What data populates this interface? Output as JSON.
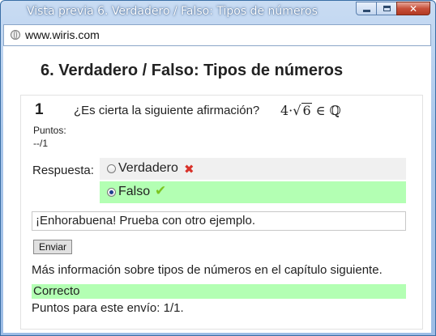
{
  "window": {
    "title": "Vista previa 6. Verdadero / Falso: Tipos de números",
    "close_glyph": "✕"
  },
  "address": {
    "url": "www.wiris.com"
  },
  "page": {
    "title": "6. Verdadero / Falso: Tipos de números",
    "question": {
      "number": "1",
      "text": "¿Es cierta la siguiente afirmación?",
      "math": {
        "coef": "4·",
        "radical": "√",
        "radicand": "6",
        "rel": " ∈ ℚ"
      },
      "points_label": "Puntos:",
      "points_value": "--/1",
      "answer_label": "Respuesta:",
      "options": [
        {
          "label": "Verdadero",
          "selected": false,
          "mark": "✖",
          "mark_icon": "cross-icon"
        },
        {
          "label": "Falso",
          "selected": true,
          "mark": "✔",
          "mark_icon": "check-icon"
        }
      ],
      "feedback": "¡Enhorabuena! Prueba con otro ejemplo.",
      "submit_label": "Enviar",
      "info": "Más información sobre tipos de números en el capítulo siguiente.",
      "status": "Correcto",
      "score": "Puntos para este envío: 1/1."
    }
  },
  "colors": {
    "correct": "#b3ffb3",
    "wrong_mark": "#d8322a",
    "right_mark": "#7cc520",
    "titlebar": "#a9c6ea"
  }
}
